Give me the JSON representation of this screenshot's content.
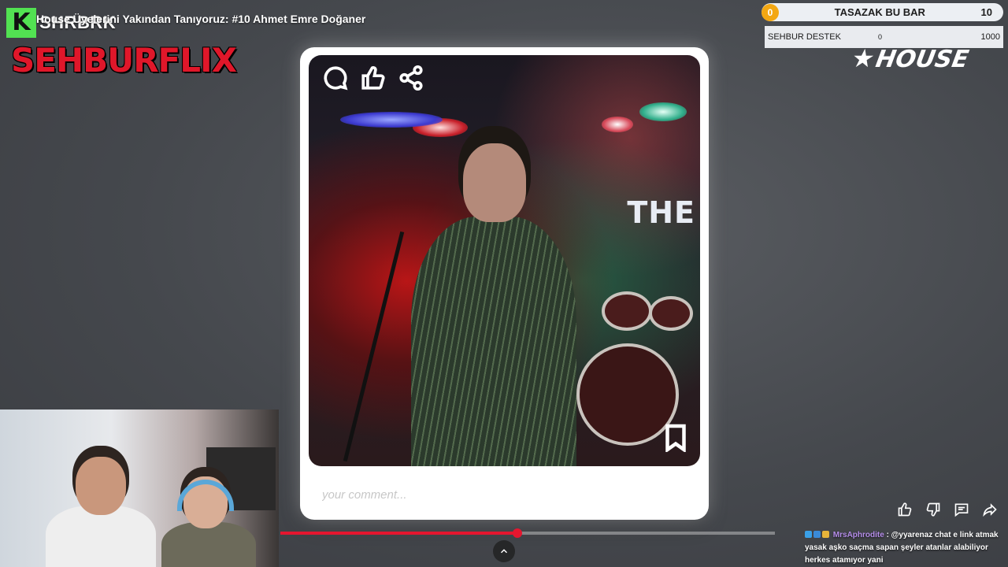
{
  "video": {
    "title": "House Üyelerini Yakından Tanıyoruz: #10 Ahmet Emre Doğaner",
    "progress_fraction": 0.48
  },
  "channel": {
    "badge_letter": "K",
    "name": "SHRBRK",
    "brand_name": "SEHBURFLIX"
  },
  "goal": {
    "count": "0",
    "label": "TASAZAK BU BAR",
    "target": "10"
  },
  "support": {
    "label": "SEHBUR DESTEK",
    "min": "0",
    "max": "1000"
  },
  "overlay_logo": {
    "text": "HOUSE"
  },
  "post": {
    "stage_text": "THE",
    "comment_placeholder": "your comment...",
    "icons": [
      "comment-icon",
      "like-icon",
      "share-icon",
      "bookmark-icon"
    ]
  },
  "actions": {
    "icons": [
      "thumbs-up-icon",
      "thumbs-down-icon",
      "comment-icon",
      "share-icon"
    ]
  },
  "chat": {
    "username": "MrsAphrodite",
    "message": ": @yyarenaz chat e link atmak yasak aşko saçma sapan şeyler atanlar alabiliyor herkes atamıyor yani",
    "badge_colors": [
      "#3aa0e8",
      "#3a8ad8",
      "#e8b43a"
    ]
  },
  "colors": {
    "accent_red": "#e5162f",
    "goal_badge": "#f3a712",
    "channel_green": "#52e252",
    "chat_username": "#b58dea"
  }
}
